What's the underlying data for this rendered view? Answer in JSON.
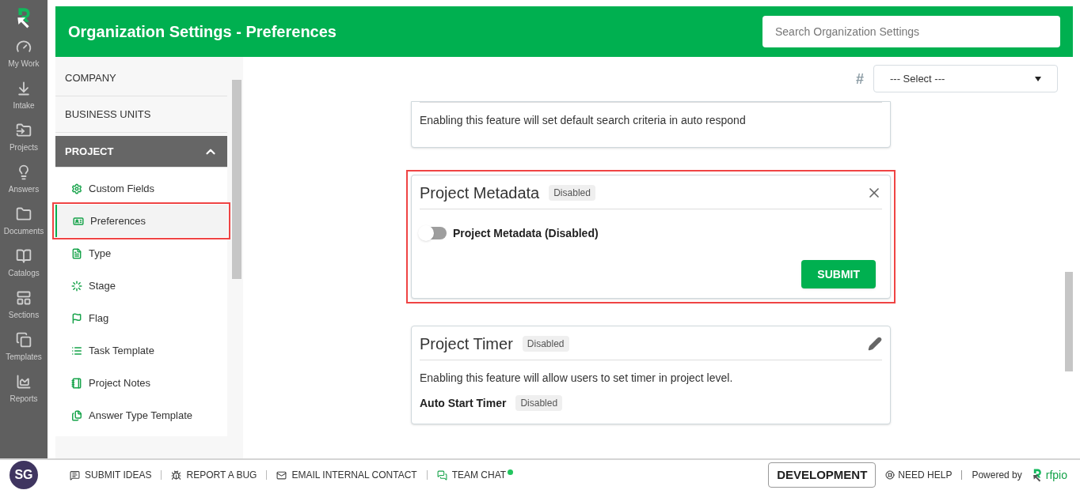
{
  "rail": {
    "items": [
      {
        "label": "My Work"
      },
      {
        "label": "Intake"
      },
      {
        "label": "Projects"
      },
      {
        "label": "Answers"
      },
      {
        "label": "Documents"
      },
      {
        "label": "Catalogs"
      },
      {
        "label": "Sections"
      },
      {
        "label": "Templates"
      },
      {
        "label": "Reports"
      }
    ],
    "avatar": "SG"
  },
  "header": {
    "title": "Organization Settings - Preferences",
    "search": {
      "placeholder": "Search Organization Settings"
    }
  },
  "nav": {
    "items": [
      {
        "label": "COMPANY",
        "expanded": false
      },
      {
        "label": "BUSINESS UNITS",
        "expanded": false
      },
      {
        "label": "PROJECT",
        "expanded": true,
        "children": [
          {
            "label": "Custom Fields",
            "selected": false,
            "highlighted": false
          },
          {
            "label": "Preferences",
            "selected": true,
            "highlighted": true
          },
          {
            "label": "Type",
            "selected": false,
            "highlighted": false
          },
          {
            "label": "Stage",
            "selected": false,
            "highlighted": false
          },
          {
            "label": "Flag",
            "selected": false,
            "highlighted": false
          },
          {
            "label": "Task Template",
            "selected": false,
            "highlighted": false
          },
          {
            "label": "Project Notes",
            "selected": false,
            "highlighted": false
          },
          {
            "label": "Answer Type Template",
            "selected": false,
            "highlighted": false
          }
        ]
      }
    ]
  },
  "filter": {
    "symbol": "#",
    "value": "--- Select ---"
  },
  "cards": [
    {
      "kind": "partial",
      "description": "Enabling this feature will set default search criteria in auto respond",
      "highlighted": false
    },
    {
      "kind": "toggle",
      "title": "Project Metadata",
      "badge": "Disabled",
      "toggle_label": "Project Metadata (Disabled)",
      "on": false,
      "button": "SUBMIT",
      "highlighted": true
    },
    {
      "kind": "timer",
      "title": "Project Timer",
      "badge": "Disabled",
      "description": "Enabling this feature will allow users to set timer in project level.",
      "setting_label": "Auto Start Timer",
      "setting_badge": "Disabled",
      "highlighted": false
    }
  ],
  "footer": {
    "links": [
      {
        "label": "SUBMIT IDEAS"
      },
      {
        "label": "REPORT A BUG"
      },
      {
        "label": "EMAIL INTERNAL CONTACT"
      },
      {
        "label": "TEAM CHAT"
      }
    ],
    "environment": "DEVELOPMENT",
    "help": "NEED HELP",
    "powered_by": "Powered by",
    "brand": "rfpio"
  }
}
